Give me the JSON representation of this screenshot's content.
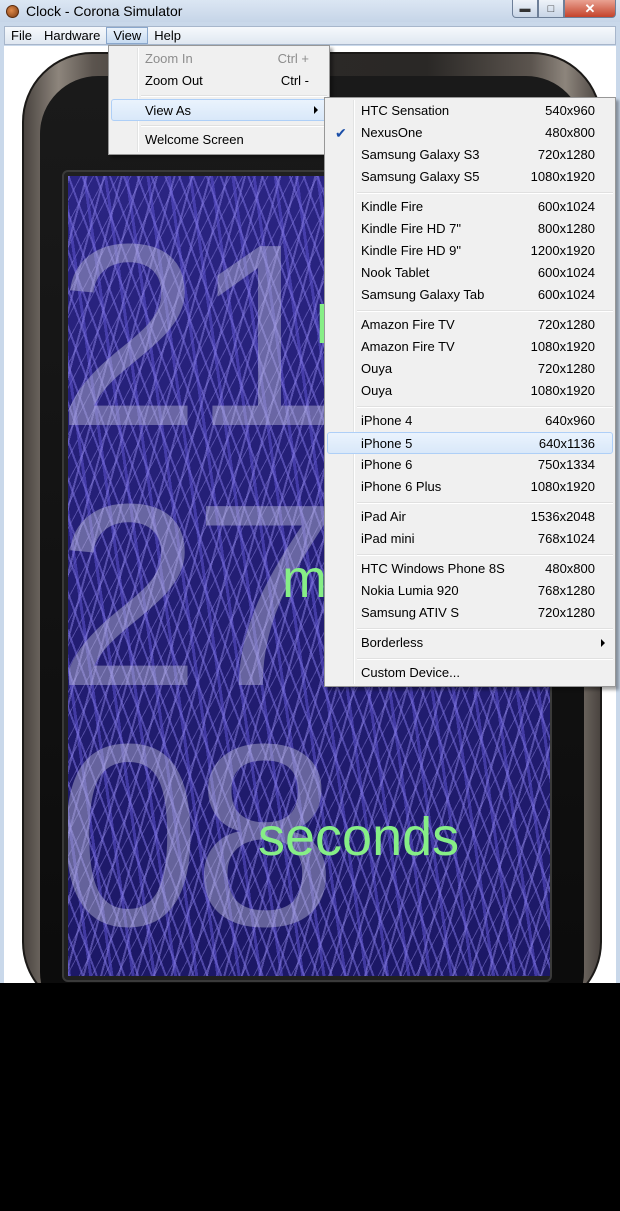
{
  "window": {
    "title": "Clock - Corona Simulator"
  },
  "menubar": {
    "items": [
      "File",
      "Hardware",
      "View",
      "Help"
    ]
  },
  "view_menu": {
    "items": [
      {
        "label": "Zoom In",
        "shortcut": "Ctrl +",
        "disabled": true
      },
      {
        "label": "Zoom Out",
        "shortcut": "Ctrl -"
      },
      {
        "label": "View As",
        "submenu": true
      },
      {
        "label": "Welcome Screen"
      }
    ]
  },
  "view_as_menu": {
    "checked": "NexusOne",
    "highlighted": "iPhone 5",
    "groups": [
      [
        {
          "label": "HTC Sensation",
          "res": "540x960"
        },
        {
          "label": "NexusOne",
          "res": "480x800"
        },
        {
          "label": "Samsung Galaxy S3",
          "res": "720x1280"
        },
        {
          "label": "Samsung Galaxy S5",
          "res": "1080x1920"
        }
      ],
      [
        {
          "label": "Kindle Fire",
          "res": "600x1024"
        },
        {
          "label": "Kindle Fire HD 7\"",
          "res": "800x1280"
        },
        {
          "label": "Kindle Fire HD 9\"",
          "res": "1200x1920"
        },
        {
          "label": "Nook Tablet",
          "res": "600x1024"
        },
        {
          "label": "Samsung Galaxy Tab",
          "res": "600x1024"
        }
      ],
      [
        {
          "label": "Amazon Fire TV",
          "res": "720x1280"
        },
        {
          "label": "Amazon Fire TV",
          "res": "1080x1920"
        },
        {
          "label": "Ouya",
          "res": "720x1280"
        },
        {
          "label": "Ouya",
          "res": "1080x1920"
        }
      ],
      [
        {
          "label": "iPhone 4",
          "res": "640x960"
        },
        {
          "label": "iPhone 5",
          "res": "640x1136"
        },
        {
          "label": "iPhone 6",
          "res": "750x1334"
        },
        {
          "label": "iPhone 6 Plus",
          "res": "1080x1920"
        }
      ],
      [
        {
          "label": "iPad Air",
          "res": "1536x2048"
        },
        {
          "label": "iPad mini",
          "res": "768x1024"
        }
      ],
      [
        {
          "label": "HTC Windows Phone 8S",
          "res": "480x800"
        },
        {
          "label": "Nokia Lumia 920",
          "res": "768x1280"
        },
        {
          "label": "Samsung ATIV S",
          "res": "720x1280"
        }
      ],
      [
        {
          "label": "Borderless",
          "submenu": true
        }
      ],
      [
        {
          "label": "Custom Device..."
        }
      ]
    ]
  },
  "clock_screen": {
    "hours_digits": "21",
    "minutes_digits": "27",
    "seconds_digits": "08",
    "hours_label": "h",
    "minutes_label": "m",
    "seconds_label": "seconds"
  }
}
